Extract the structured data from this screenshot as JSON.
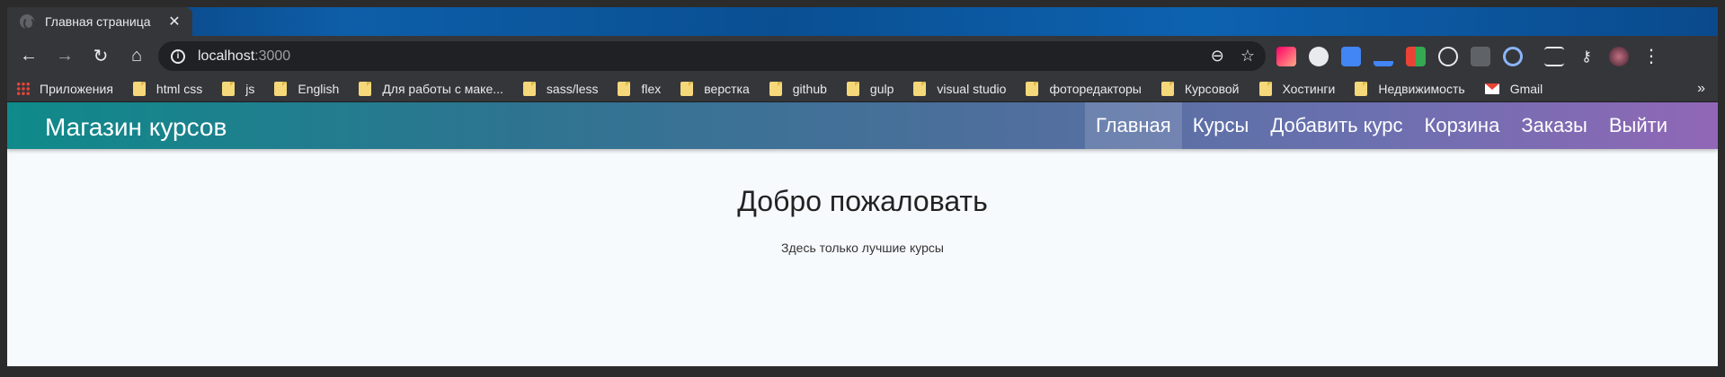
{
  "browser": {
    "tab": {
      "title": "Главная страница",
      "close": "✕"
    },
    "toolbar": {
      "back": "←",
      "forward": "→",
      "reload": "↻",
      "home": "⌂",
      "url_host": "localhost",
      "url_port": ":3000",
      "zoom_icon": "⊖",
      "star_icon": "☆",
      "menu_icon": "⋮"
    },
    "bookmarks": {
      "items": [
        "Приложения",
        "html css",
        "js",
        "English",
        "Для работы с маке...",
        "sass/less",
        "flex",
        "верстка",
        "github",
        "gulp",
        "visual studio",
        "фоторедакторы",
        "Курсовой",
        "Хостинги",
        "Недвижимость",
        "Gmail"
      ],
      "more": "»"
    }
  },
  "site": {
    "brand": "Магазин курсов",
    "nav": [
      "Главная",
      "Курсы",
      "Добавить курс",
      "Корзина",
      "Заказы",
      "Выйти"
    ],
    "hero": {
      "title": "Добро пожаловать",
      "subtitle": "Здесь только лучшие курсы"
    }
  }
}
